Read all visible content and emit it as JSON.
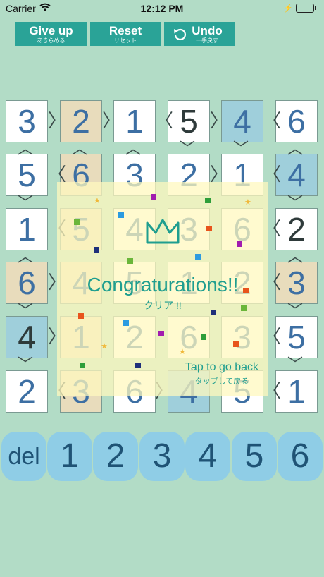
{
  "status_bar": {
    "carrier": "Carrier",
    "time": "12:12 PM"
  },
  "toolbar": {
    "give_up": {
      "label": "Give up",
      "sublabel": "あきらめる"
    },
    "reset": {
      "label": "Reset",
      "sublabel": "リセット"
    },
    "undo": {
      "label": "Undo",
      "sublabel": "一手戻す"
    }
  },
  "board": {
    "cells": [
      [
        "3",
        "2",
        "1",
        "5",
        "4",
        "6"
      ],
      [
        "5",
        "6",
        "3",
        "2",
        "1",
        "4"
      ],
      [
        "1",
        "5",
        "4",
        "3",
        "6",
        "2"
      ],
      [
        "6",
        "4",
        "5",
        "1",
        "2",
        "3"
      ],
      [
        "4",
        "1",
        "2",
        "6",
        "3",
        "5"
      ],
      [
        "2",
        "3",
        "6",
        "4",
        "5",
        "1"
      ]
    ]
  },
  "result": {
    "title": "Congraturations!!",
    "subtitle": "クリア !!",
    "back_label": "Tap to go back",
    "back_sublabel": "タップして戻る"
  },
  "keypad": {
    "keys": [
      "del",
      "1",
      "2",
      "3",
      "4",
      "5",
      "6"
    ]
  },
  "colors": {
    "background": "#b2dcc6",
    "button": "#2aa397",
    "key": "#8fcde6",
    "overlay_text": "#1f9e8f"
  }
}
